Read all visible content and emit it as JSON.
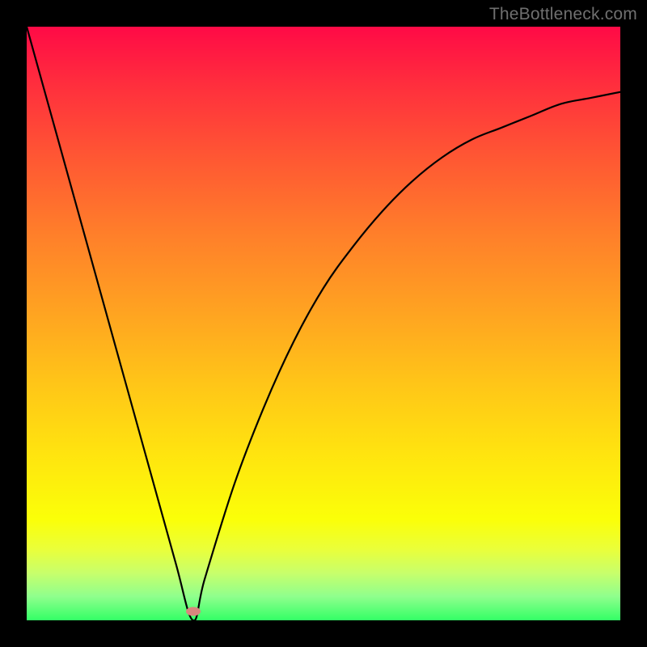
{
  "watermark": "TheBottleneck.com",
  "chart_data": {
    "type": "line",
    "title": "",
    "xlabel": "",
    "ylabel": "",
    "xlim": [
      0,
      100
    ],
    "ylim": [
      0,
      100
    ],
    "grid": false,
    "legend": false,
    "series": [
      {
        "name": "curve",
        "x": [
          0,
          5,
          10,
          15,
          20,
          25,
          28,
          30,
          35,
          40,
          45,
          50,
          55,
          60,
          65,
          70,
          75,
          80,
          85,
          90,
          95,
          100
        ],
        "values": [
          100,
          82,
          64,
          46,
          28,
          10,
          0,
          7,
          23,
          36,
          47,
          56,
          63,
          69,
          74,
          78,
          81,
          83,
          85,
          87,
          88,
          89
        ]
      }
    ],
    "marker": {
      "x": 28,
      "y": 1.5,
      "color": "#d9867e"
    },
    "gradient_stops": [
      {
        "pos": 0.0,
        "color": "#ff0a46"
      },
      {
        "pos": 0.1,
        "color": "#ff2f3d"
      },
      {
        "pos": 0.22,
        "color": "#ff5733"
      },
      {
        "pos": 0.35,
        "color": "#ff7f2a"
      },
      {
        "pos": 0.48,
        "color": "#ffa321"
      },
      {
        "pos": 0.6,
        "color": "#ffc518"
      },
      {
        "pos": 0.72,
        "color": "#ffe40f"
      },
      {
        "pos": 0.83,
        "color": "#fbff08"
      },
      {
        "pos": 0.88,
        "color": "#eaff3a"
      },
      {
        "pos": 0.92,
        "color": "#c8ff6b"
      },
      {
        "pos": 0.96,
        "color": "#8fff8d"
      },
      {
        "pos": 1.0,
        "color": "#33ff66"
      }
    ]
  }
}
